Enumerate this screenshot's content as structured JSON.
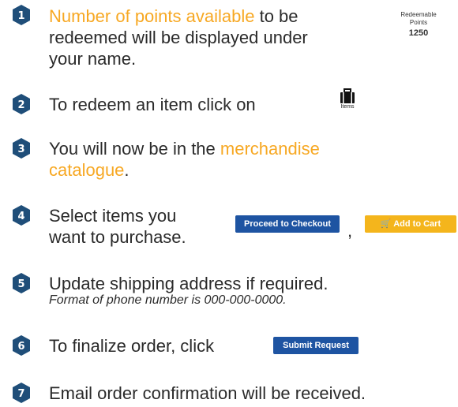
{
  "steps": [
    {
      "num": "1"
    },
    {
      "num": "2",
      "text": "To redeem an item click on"
    },
    {
      "num": "3",
      "text_a": "You will now be in the ",
      "hl_a": "merchandise",
      "hl_b": "catalogue",
      "text_b": "."
    },
    {
      "num": "4",
      "line1": "Select items you",
      "line2": "want to purchase."
    },
    {
      "num": "5",
      "line1": "Update shipping address if required.",
      "note": "Format of phone number is 000-000-0000."
    },
    {
      "num": "6",
      "text": "To finalize order, click"
    },
    {
      "num": "7",
      "text": "Email order confirmation will be received."
    }
  ],
  "step1": {
    "hl": "Number of points available",
    "line1_rest": " to be",
    "line2": "redeemed will be displayed under",
    "line3": "your name."
  },
  "points_widget": {
    "label1": "Redeemable",
    "label2": "Points",
    "value": "1250"
  },
  "items_widget": {
    "icon": "briefcase-icon",
    "label": "Items"
  },
  "buttons": {
    "proceed": "Proceed to Checkout",
    "comma": ",",
    "add_to_cart": "Add to Cart",
    "submit": "Submit Request"
  },
  "colors": {
    "badge": "#1f4e79",
    "highlight": "#f7a823",
    "button_blue": "#1e54a2",
    "button_gold": "#f4b51c"
  }
}
